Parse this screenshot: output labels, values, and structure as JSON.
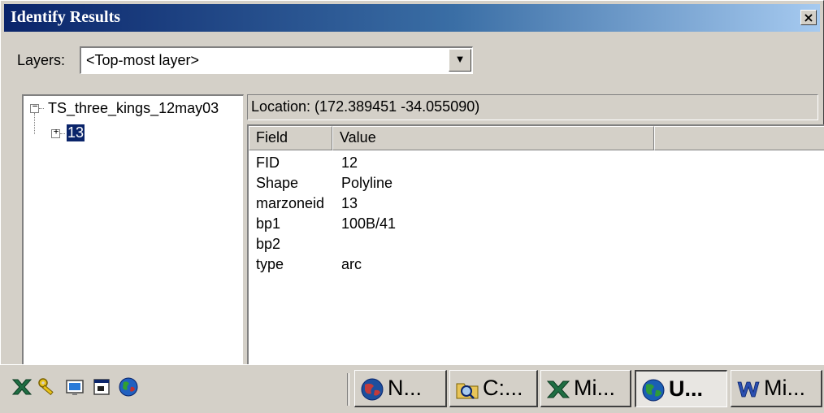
{
  "window": {
    "title": "Identify Results",
    "close_glyph": "×"
  },
  "layers": {
    "label": "Layers:",
    "selected": "<Top-most layer>",
    "dropdown_glyph": "▼"
  },
  "tree": {
    "root": {
      "label": "TS_three_kings_12may03",
      "expander": "−"
    },
    "child": {
      "label": "13",
      "expander": "+"
    }
  },
  "location": "Location: (172.389451 -34.055090)",
  "table": {
    "headers": [
      "Field",
      "Value"
    ],
    "rows": [
      [
        "FID",
        "12"
      ],
      [
        "Shape",
        "Polyline"
      ],
      [
        "marzoneid",
        "13"
      ],
      [
        "bp1",
        "100B/41"
      ],
      [
        "bp2",
        ""
      ],
      [
        "type",
        "arc"
      ]
    ]
  },
  "taskbar": {
    "tray_icons": [
      "excel-icon",
      "keys-icon",
      "monitor-icon",
      "window-icon",
      "globe-icon"
    ],
    "buttons": [
      {
        "label": "N...",
        "icon": "netscape-globe-icon",
        "active": false
      },
      {
        "label": "C:...",
        "icon": "explorer-folder-icon",
        "active": false
      },
      {
        "label": "Mi...",
        "icon": "excel-icon",
        "active": false
      },
      {
        "label": "U...",
        "icon": "globe-icon",
        "active": true
      },
      {
        "label": "Mi...",
        "icon": "word-icon",
        "active": false
      }
    ]
  },
  "colors": {
    "titlebar_start": "#0a246a",
    "titlebar_end": "#a6caf0",
    "face": "#d4d0c8",
    "selection": "#0a246a"
  }
}
